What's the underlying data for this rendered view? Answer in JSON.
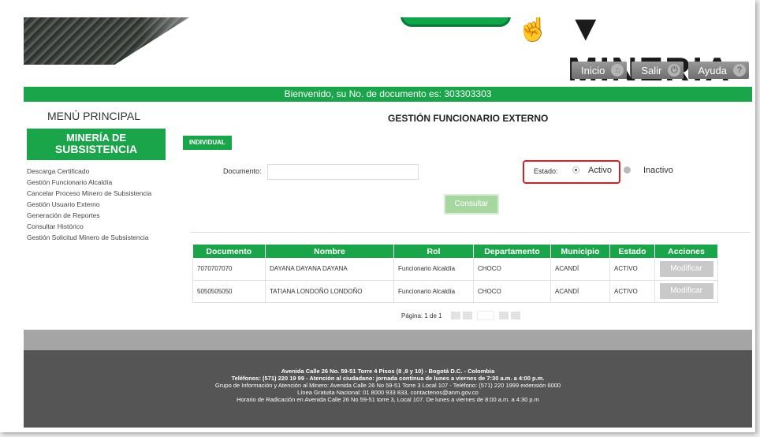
{
  "header": {
    "title": "▼ MINERIA",
    "nav": [
      {
        "label": "Inicio",
        "icon": "home-icon"
      },
      {
        "label": "Salir",
        "icon": "power-icon"
      },
      {
        "label": "Ayuda",
        "icon": "help-icon"
      }
    ]
  },
  "welcome": "Bienvenido, su No. de documento es: 303303303",
  "sidebar": {
    "title": "MENÚ PRINCIPAL",
    "section": {
      "line1": "MINERÍA DE",
      "line2": "SUBSISTENCIA"
    },
    "items": [
      {
        "label": "Descarga Certificado"
      },
      {
        "label": "Gestión Funcionario Alcaldía"
      },
      {
        "label": "Cancelar Proceso Minero de Subsistencia"
      },
      {
        "label": "Gestión Usuario Externo"
      },
      {
        "label": "Generación de Reportes"
      },
      {
        "label": "Consultar Histórico"
      },
      {
        "label": "Gestión Solicitud Minero de Subsistencia"
      }
    ]
  },
  "main": {
    "title": "GESTIÓN FUNCIONARIO EXTERNO",
    "tab": "INDIVIDUAL",
    "documento_label": "Documento:",
    "documento_value": "",
    "estado_label": "Estado:",
    "estado_options": {
      "activo": "Activo",
      "inactivo": "Inactivo"
    },
    "estado_selected": "Activo",
    "consultar": "Consultar",
    "table": {
      "headers": [
        "Documento",
        "Nombre",
        "Rol",
        "Departamento",
        "Municipio",
        "Estado",
        "Acciones"
      ],
      "rows": [
        {
          "documento": "7070707070",
          "nombre": "DAYANA DAYANA DAYANA",
          "rol": "Funcionario Alcaldía",
          "departamento": "CHOCO",
          "municipio": "ACANDÍ",
          "estado": "ACTIVO",
          "accion": "Modificar"
        },
        {
          "documento": "5050505050",
          "nombre": "TATIANA LONDOÑO LONDOÑO",
          "rol": "Funcionario Alcaldía",
          "departamento": "CHOCO",
          "municipio": "ACANDÍ",
          "estado": "ACTIVO",
          "accion": "Modificar"
        }
      ]
    },
    "pager": {
      "label": "Página: 1 de 1"
    }
  },
  "footer": {
    "lines": [
      {
        "text": "Avenida Calle 26 No. 59-51 Torre 4 Pisos (8 ,9 y 10) - Bogotá D.C. - Colombia",
        "bold": true
      },
      {
        "text": "Teléfonos: (571) 220 19 99 - Atención al ciudadano: jornada continua de lunes a viernes de 7:30 a.m. a 4:00 p.m.",
        "bold": true
      },
      {
        "text": "Grupo de Información y Atención al Minero: Avenida Calle 26 No 59-51 Torre 3 Local 107 - Teléfono: (571) 220 1999 extensión 6000",
        "bold": false
      },
      {
        "text": "Línea Gratuita Nacional: 01 8000 933 833, contactenos@anm.gov.co",
        "bold": false
      },
      {
        "text": "Horario de Radicación en Avenida Calle 26 No 59-51 torre 3, Local 107. De lunes a viernes de 8:00 a.m. a 4:30 p.m",
        "bold": false
      }
    ]
  },
  "colors": {
    "accent": "#1aa54a",
    "highlight": "#d61f26",
    "footer": "#555555"
  }
}
